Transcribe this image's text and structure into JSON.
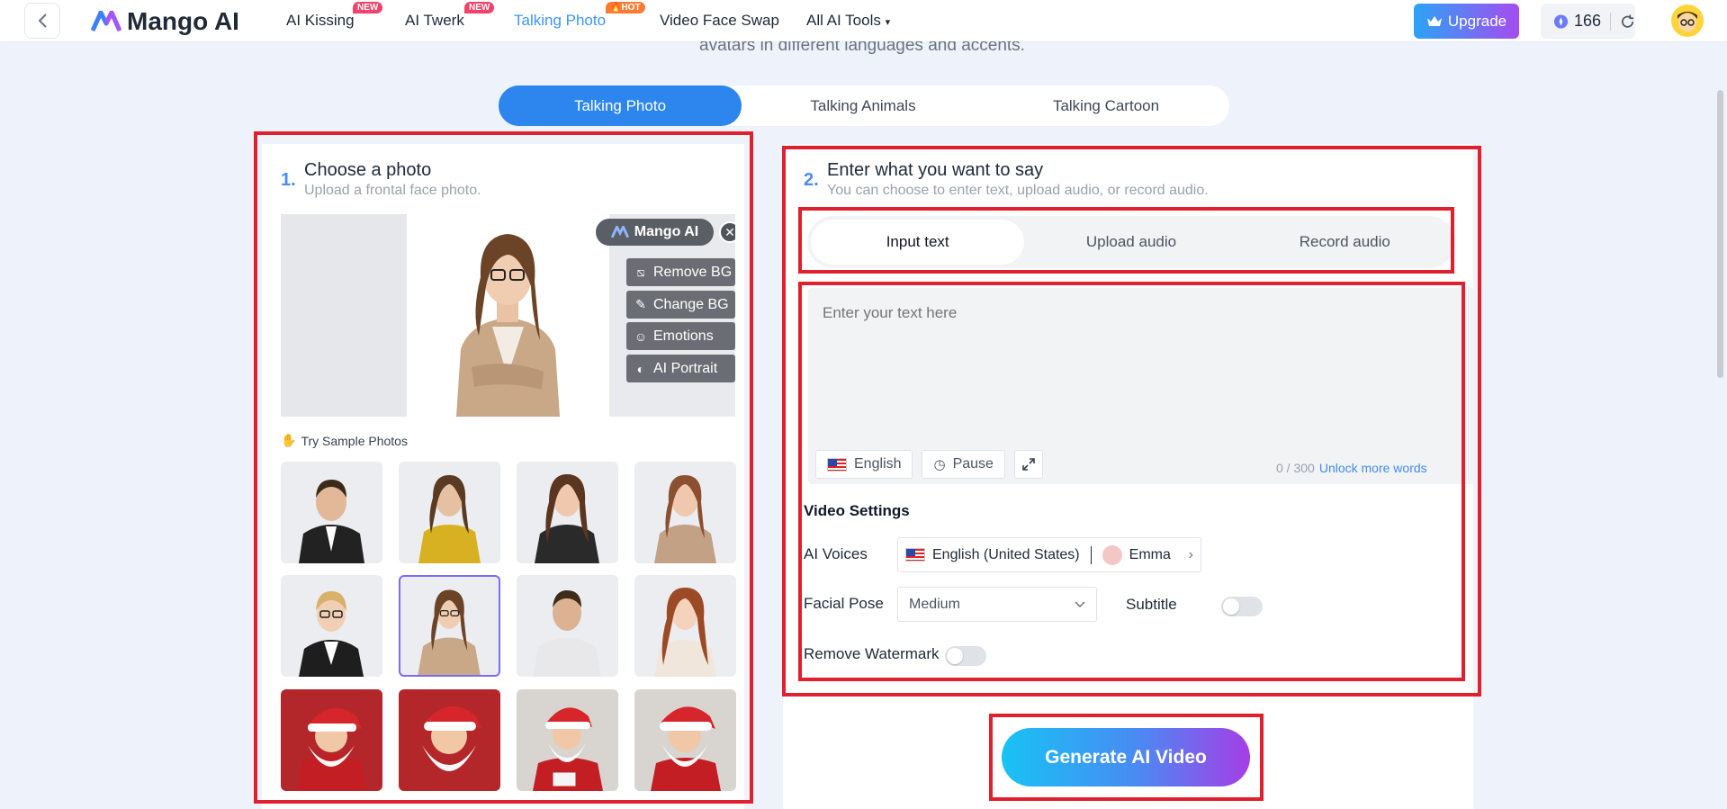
{
  "header": {
    "logo_text": "Mango AI",
    "nav": [
      {
        "label": "AI Kissing",
        "badge": "NEW"
      },
      {
        "label": "AI Twerk",
        "badge": "NEW"
      },
      {
        "label": "Talking Photo",
        "badge": "HOT"
      },
      {
        "label": "Video Face Swap"
      },
      {
        "label": "All AI Tools"
      }
    ],
    "upgrade_label": "Upgrade",
    "credits": "166"
  },
  "intro_text": "avatars in different languages and accents.",
  "top_tabs": [
    "Talking Photo",
    "Talking Animals",
    "Talking Cartoon"
  ],
  "left": {
    "step_num": "1.",
    "title": "Choose a photo",
    "subtitle": "Upload a frontal face photo.",
    "brand_tag": "Mango AI",
    "tools": [
      "Remove BG",
      "Change BG",
      "Emotions",
      "AI Portrait"
    ],
    "try_label": "Try Sample Photos"
  },
  "right": {
    "step_num": "2.",
    "title": "Enter what you want to say",
    "subtitle": "You can choose to enter text, upload audio, or record audio.",
    "segments": [
      "Input text",
      "Upload audio",
      "Record audio"
    ],
    "text_placeholder": "Enter your text here",
    "language": "English",
    "pause": "Pause",
    "counter": "0 / 300",
    "unlock": "Unlock more words",
    "video_settings": "Video Settings",
    "ai_voices_label": "AI Voices",
    "voice_lang": "English (United States)",
    "voice_name": "Emma",
    "facial_pose_label": "Facial Pose",
    "facial_pose_value": "Medium",
    "subtitle_label": "Subtitle",
    "remove_watermark_label": "Remove Watermark",
    "subtitle_toggle": false,
    "watermark_toggle": false
  },
  "generate_label": "Generate AI Video",
  "colors": {
    "accent": "#2c86ee",
    "annotation_red": "#e0202e",
    "hot_badge": "#ff7a33",
    "new_badge": "#f0436b"
  }
}
